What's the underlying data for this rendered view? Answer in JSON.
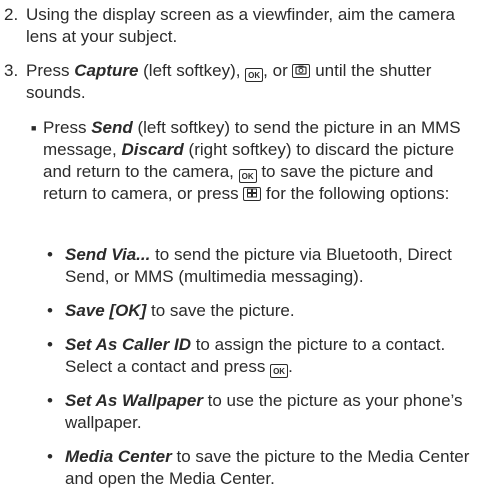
{
  "steps": [
    {
      "number": "2.",
      "text": "Using the display screen as a viewfinder, aim the camera lens at your subject."
    },
    {
      "number": "3.",
      "pre": "Press ",
      "capture": "Capture",
      "mid": " (left softkey), ",
      "sep": ", or ",
      "post": " until the shutter sounds."
    }
  ],
  "main_bullet": {
    "p1": "Press ",
    "send": "Send",
    "p2": " (left softkey) to send the picture in an MMS message, ",
    "discard": "Discard",
    "p3": " (right softkey) to discard the picture and return to the camera, ",
    "p4": " to save the picture and return to camera, or press ",
    "p5": " for the following options:"
  },
  "options": [
    {
      "label": "Send Via...",
      "text": " to send the picture via Bluetooth, Direct Send, or MMS (multimedia messaging)."
    },
    {
      "label": "Save [OK]",
      "text": " to save the picture."
    },
    {
      "label": "Set As Caller ID",
      "text": " to assign the picture to a contact. Select a contact and press ",
      "tail": "."
    },
    {
      "label": "Set As Wallpaper",
      "text": " to use the picture as your phone’s wallpaper."
    },
    {
      "label": "Media Center",
      "text": " to save the picture to the Media Center and open the Media Center."
    }
  ],
  "icons": {
    "ok_key": "OK",
    "bullet_square": "■",
    "bullet_dot": "•"
  }
}
